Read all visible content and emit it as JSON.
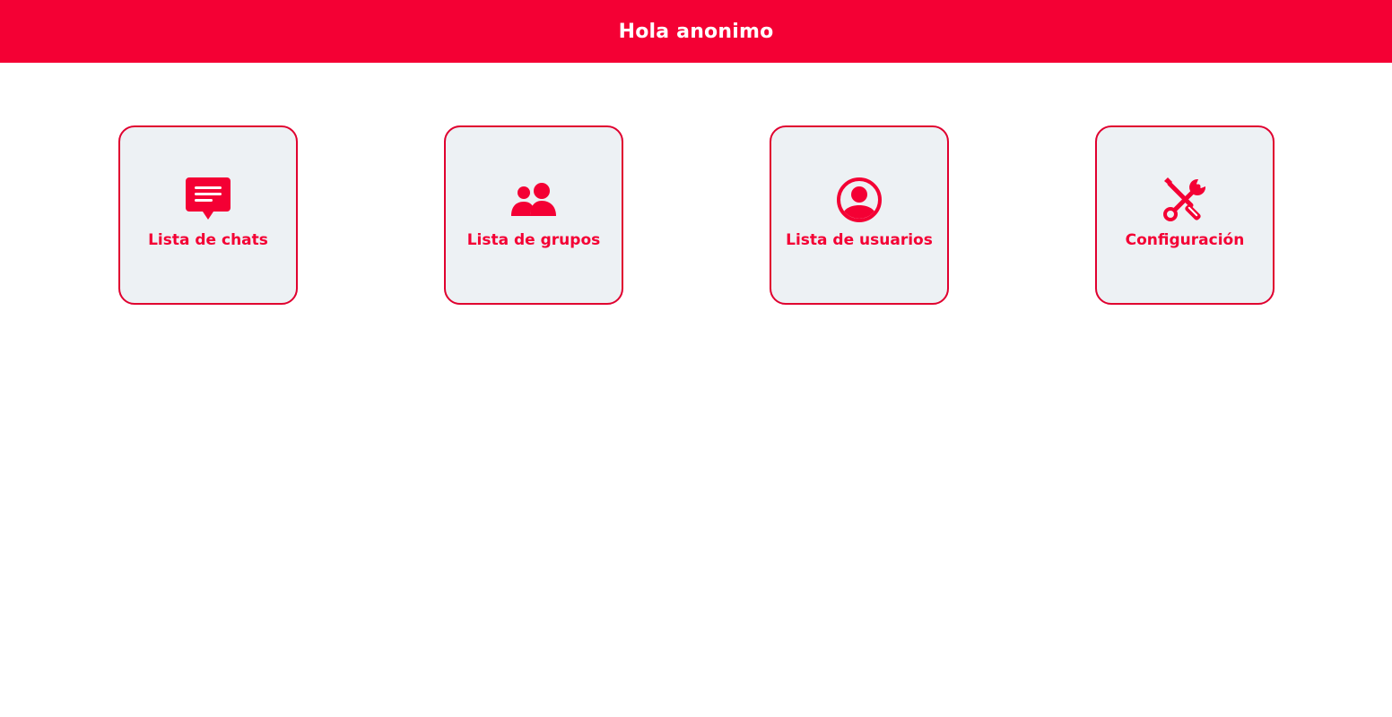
{
  "header": {
    "title": "Hola anonimo",
    "background_color": "#f40034",
    "text_color": "#ffffff"
  },
  "menu": {
    "accent_color": "#f40034",
    "tile_background": "#edf1f4",
    "items": [
      {
        "label": "Lista de chats",
        "icon": "chat-bubble-icon"
      },
      {
        "label": "Lista de grupos",
        "icon": "group-icon"
      },
      {
        "label": "Lista de usuarios",
        "icon": "user-circle-icon"
      },
      {
        "label": "Configuración",
        "icon": "tools-icon"
      }
    ]
  }
}
